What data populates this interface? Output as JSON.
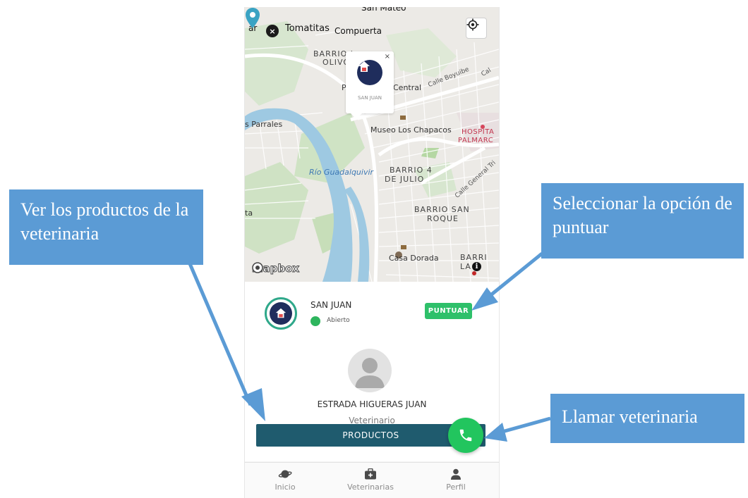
{
  "map": {
    "labels": {
      "san_mateo": "San Mateo",
      "ar": "ar",
      "tomatitas": "Tomatitas",
      "compuerta": "Compuerta",
      "barrio_olivo_1": "BARRIO I",
      "barrio_olivo_2": "OLIVO",
      "calle_bolivia": "Calle Boyuibe",
      "central": "Central",
      "parrales": "s Parrales",
      "museo": "Museo Los Chapacos",
      "hospital_1": "HOSPITA",
      "hospital_2": "PALMARC",
      "rio": "Río Guadalquivir",
      "barrio4_1": "BARRIO 4",
      "barrio4_2": "DE JULIO",
      "calle_general": "Calle General Tri",
      "barrio_san_roque_1": "BARRIO SAN",
      "barrio_san_roque_2": "ROQUE",
      "ta": "ta",
      "casa_dorada": "Casa Dorada",
      "barrio_la_1": "BARRI",
      "barrio_la_2": "LA",
      "p_letter": "P",
      "cal": "Cal",
      "mapbox": "mapbox"
    },
    "popup": {
      "name": "SAN JUAN",
      "close": "×"
    },
    "close_button": "×",
    "info": "i"
  },
  "card": {
    "vet_name": "SAN JUAN",
    "status": "Abierto",
    "puntuar": "PUNTUAR",
    "doctor_name": "ESTRADA HIGUERAS JUAN",
    "doctor_role": "Veterinario",
    "productos": "PRODUCTOS"
  },
  "nav": {
    "items": [
      {
        "label": "Inicio",
        "icon": "planet-icon"
      },
      {
        "label": "Veterinarias",
        "icon": "medical-bag-icon"
      },
      {
        "label": "Perfil",
        "icon": "user-icon"
      }
    ]
  },
  "callouts": {
    "productos": "Ver los productos de la veterinaria",
    "puntuar": "Seleccionar la opción de puntuar",
    "llamar": "Llamar veterinaria"
  },
  "colors": {
    "callout": "#5b9bd5",
    "productos_button": "#1f5b6e",
    "puntuar_button": "#2ec06a",
    "call_button": "#22c55e",
    "status_open": "#2db55d"
  }
}
